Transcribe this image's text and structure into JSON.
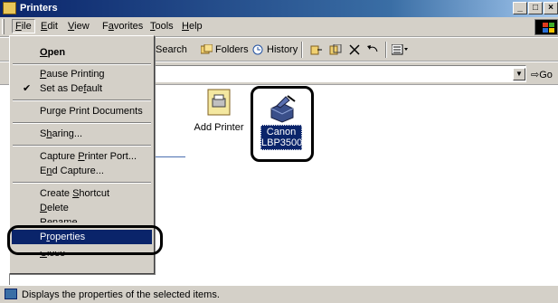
{
  "window": {
    "title": "Printers"
  },
  "menubar": {
    "items": [
      {
        "label": "File",
        "ul": "F",
        "rest": "ile"
      },
      {
        "label": "Edit",
        "ul": "E",
        "rest": "dit"
      },
      {
        "label": "View",
        "ul": "V",
        "rest": "iew"
      },
      {
        "label": "Favorites",
        "pre": "F",
        "ul": "a",
        "rest": "vorites"
      },
      {
        "label": "Tools",
        "ul": "T",
        "rest": "ools"
      },
      {
        "label": "Help",
        "ul": "H",
        "rest": "elp"
      }
    ]
  },
  "toolbar": {
    "search": "Search",
    "folders": "Folders",
    "history": "History"
  },
  "address": {
    "go": "Go"
  },
  "file_menu": {
    "open": "Open",
    "pause_printing": "Pause Printing",
    "set_default": "Set as Default",
    "purge": "Purge Print Documents",
    "sharing": "Sharing...",
    "capture_port": "Capture Printer Port...",
    "end_capture": "End Capture...",
    "create_shortcut": "Create Shortcut",
    "delete": "Delete",
    "rename": "Rename",
    "properties": "Properties",
    "close": "Close"
  },
  "icons": {
    "add_printer": "Add Printer",
    "canon_line1": "Canon",
    "canon_line2": "LBP3500"
  },
  "status": {
    "text": "Displays the properties of the selected items."
  },
  "colors": {
    "highlight": "#0a246a",
    "face": "#d4d0c8"
  }
}
